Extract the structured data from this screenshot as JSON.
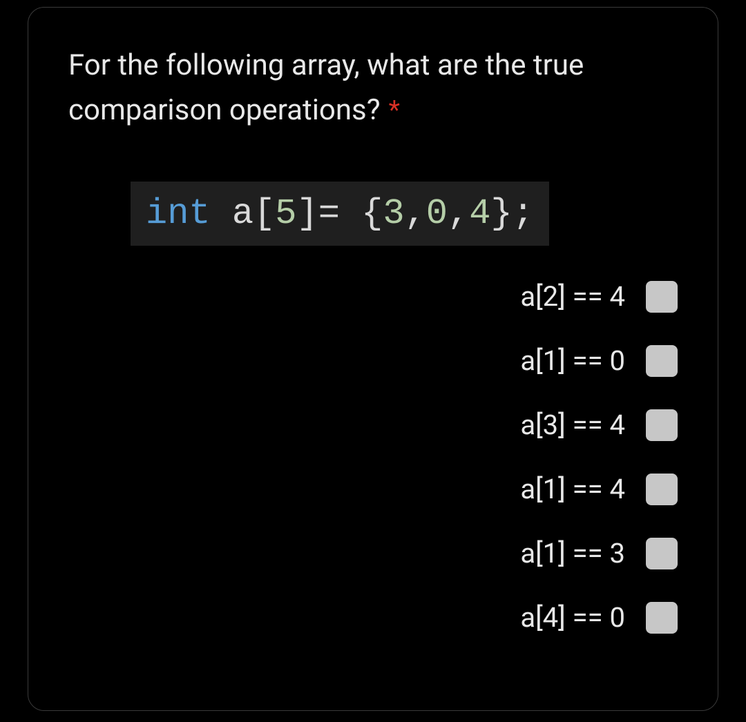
{
  "question": {
    "line1": "For the following array, what are the true",
    "line2": "comparison operations?",
    "required_marker": "*"
  },
  "code": {
    "keyword": "int",
    "identifier": "a",
    "open_bracket": "[",
    "size": "5",
    "close_bracket": "]",
    "assign": "= ",
    "open_brace": "{",
    "v1": "3",
    "c1": ",",
    "v2": "0",
    "c2": ",",
    "v3": "4",
    "close_brace": "}",
    "semi": ";"
  },
  "options": [
    {
      "label": "a[2] == 4"
    },
    {
      "label": "a[1] == 0"
    },
    {
      "label": "a[3] == 4"
    },
    {
      "label": "a[1] == 4"
    },
    {
      "label": "a[1] == 3"
    },
    {
      "label": "a[4] == 0"
    }
  ]
}
